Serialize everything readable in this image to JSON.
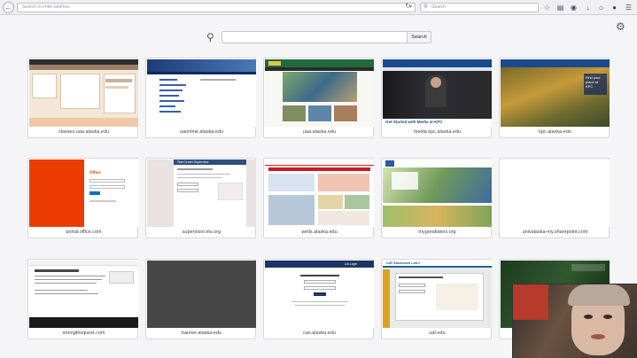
{
  "toolbar": {
    "url_placeholder": "Search or enter address",
    "search_placeholder": "Search",
    "icons": [
      "back-arrow-icon",
      "dropdown-arrow-icon",
      "reload-icon",
      "search-icon",
      "bookmark-star-icon",
      "reading-list-icon",
      "pocket-icon",
      "downloads-icon",
      "home-icon",
      "chat-icon",
      "menu-icon"
    ]
  },
  "newtab": {
    "search_button": "Search",
    "tiles": [
      {
        "label": "classes.uaa.alaska.edu"
      },
      {
        "label": "uaonline.alaska.edu"
      },
      {
        "label": "uaa.alaska.edu"
      },
      {
        "label": "media.kpc.alaska.edu"
      },
      {
        "label": "kpc.alaska.edu"
      },
      {
        "label": "portal.office.com"
      },
      {
        "label": "supervisor.ets.org"
      },
      {
        "label": "wells.alaska.edu"
      },
      {
        "label": "mygreatlakes.org"
      },
      {
        "label": "univalaska-my.sharepoint.com"
      },
      {
        "label": "strengthsquest.com"
      },
      {
        "label": "banner.alaska.edu"
      },
      {
        "label": "cas.alaska.edu"
      },
      {
        "label": "uaf.edu"
      },
      {
        "label": ""
      }
    ]
  },
  "thumb_text": {
    "kpc_media_caption": "Get Started with Media at KPC",
    "kpc_overlay": "Find your place at KPC",
    "office_logo": "Office",
    "ets_header": "Test Center Supervisor",
    "cas_header": "UA Login",
    "blackboard_header": "UAF Blackboard Learn"
  },
  "colors": {
    "office_orange": "#eb3c00",
    "uaa_green": "#1f6b3a",
    "kpc_blue": "#1b4a8c",
    "banner_gray": "#474747"
  }
}
